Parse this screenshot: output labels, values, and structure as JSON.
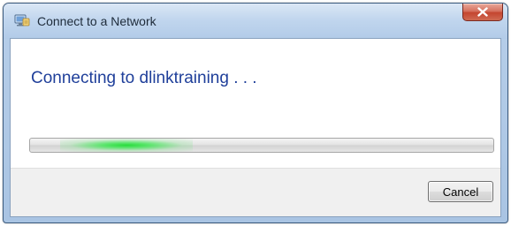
{
  "window": {
    "title": "Connect to a Network",
    "icon": "network-connect-icon",
    "close_icon": "close-icon"
  },
  "main": {
    "status_text": "Connecting to dlinktraining . . ."
  },
  "progress": {
    "style": "marquee",
    "indeterminate": true,
    "color": "#2fd64a"
  },
  "footer": {
    "cancel_label": "Cancel"
  },
  "colors": {
    "heading": "#1f3f9a",
    "title_bar": "#c1d6ee",
    "close_button": "#c4452f"
  }
}
